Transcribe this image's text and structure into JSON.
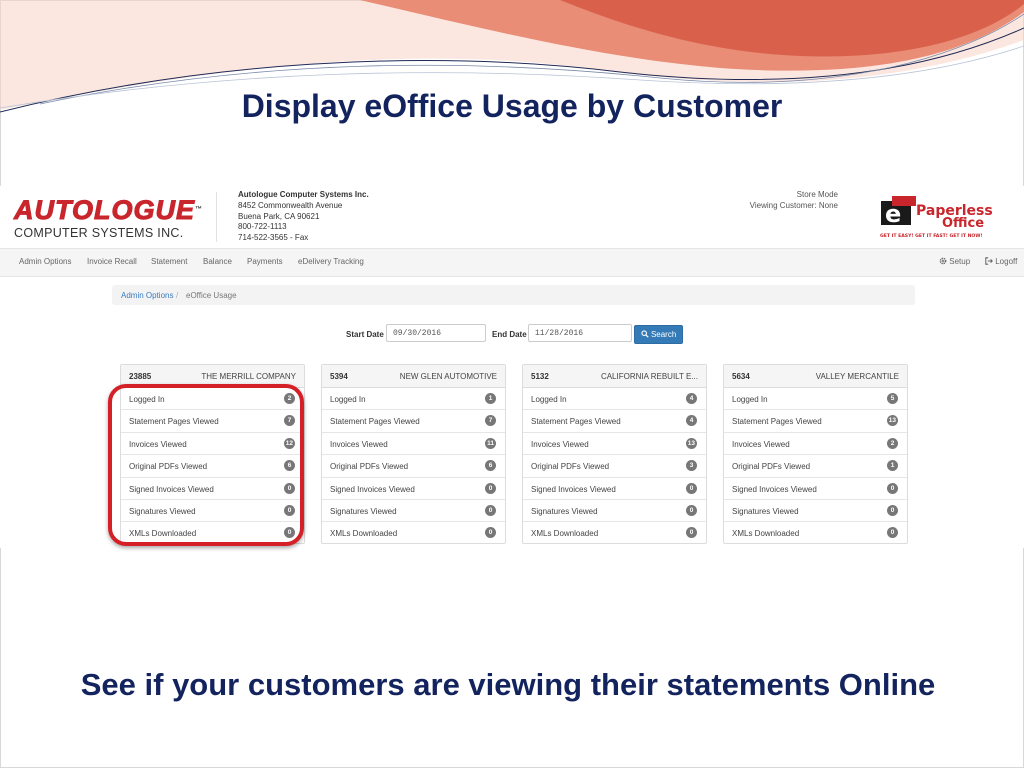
{
  "slide": {
    "title": "Display eOffice Usage by Customer",
    "subtitle": "See if your customers are viewing their statements Online"
  },
  "header": {
    "logo_main": "AUTOLOGUE",
    "logo_tm": "™",
    "logo_sub": "COMPUTER SYSTEMS INC.",
    "company_lines": [
      "Autologue Computer Systems Inc.",
      "8452 Commonwealth Avenue",
      "Buena Park, CA 90621",
      "800-722-1113",
      "714-522-3565 - Fax"
    ],
    "store_mode": "Store Mode",
    "viewing_customer": "Viewing Customer: None",
    "paperless_logo_e": "e",
    "paperless_logo_line1": "Paperless",
    "paperless_logo_line2": "Office",
    "paperless_tagline": "GET IT EASY! GET IT FAST! GET IT NOW!"
  },
  "nav": {
    "items": [
      "Admin Options",
      "Invoice Recall",
      "Statement",
      "Balance",
      "Payments",
      "eDelivery Tracking"
    ],
    "setup": "Setup",
    "logoff": "Logoff",
    "setup_icon": "gear-icon",
    "logoff_icon": "logout-icon"
  },
  "breadcrumb": {
    "link": "Admin Options",
    "separator": "/",
    "current": "eOffice Usage"
  },
  "filters": {
    "start_label": "Start Date",
    "start_value": "09/30/2016",
    "end_label": "End Date",
    "end_value": "11/28/2016",
    "search_label": "Search",
    "search_icon": "search-icon"
  },
  "row_labels": [
    "Logged In",
    "Statement Pages Viewed",
    "Invoices Viewed",
    "Original PDFs Viewed",
    "Signed Invoices Viewed",
    "Signatures Viewed",
    "XMLs Downloaded"
  ],
  "customers": [
    {
      "account": "23885",
      "name": "THE MERRILL COMPANY",
      "counts": [
        "2",
        "7",
        "12",
        "6",
        "0",
        "0",
        "0"
      ]
    },
    {
      "account": "5394",
      "name": "NEW GLEN AUTOMOTIVE",
      "counts": [
        "1",
        "7",
        "11",
        "6",
        "0",
        "0",
        "0"
      ]
    },
    {
      "account": "5132",
      "name": "CALIFORNIA REBUILT E...",
      "counts": [
        "4",
        "4",
        "13",
        "3",
        "0",
        "0",
        "0"
      ]
    },
    {
      "account": "5634",
      "name": "VALLEY MERCANTILE",
      "counts": [
        "5",
        "13",
        "2",
        "1",
        "0",
        "0",
        "0"
      ]
    }
  ],
  "colors": {
    "title": "#13235e",
    "highlight": "#d42027",
    "button": "#337ab7",
    "badge": "#777777",
    "logo_red": "#c8262c"
  }
}
